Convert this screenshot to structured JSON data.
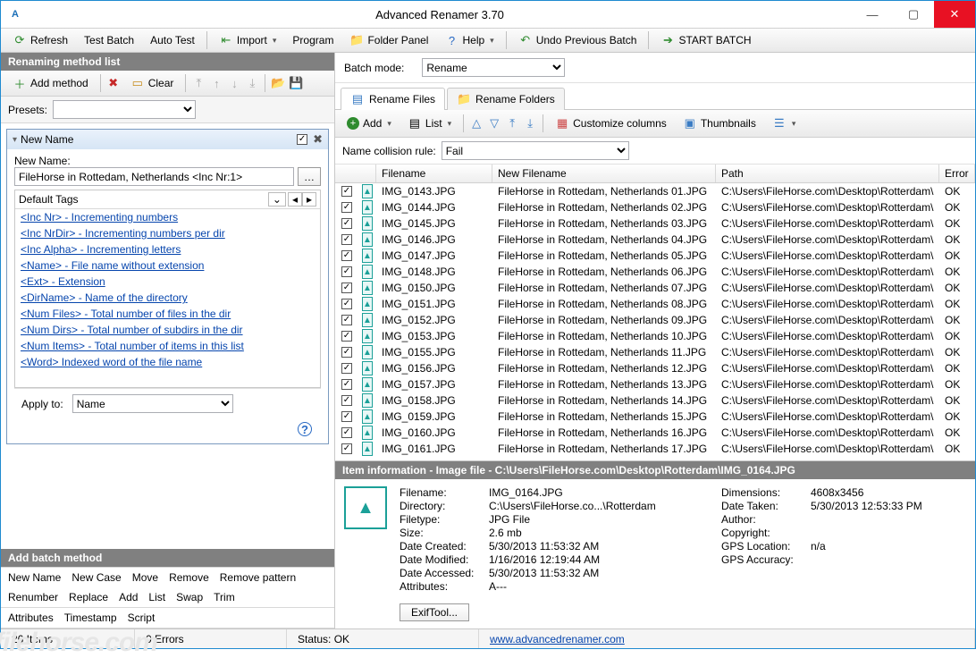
{
  "window": {
    "title": "Advanced Renamer 3.70"
  },
  "toolbar": {
    "refresh": "Refresh",
    "test_batch": "Test Batch",
    "auto_test": "Auto Test",
    "import": "Import",
    "program": "Program",
    "folder_panel": "Folder Panel",
    "help": "Help",
    "undo": "Undo Previous Batch",
    "start": "START BATCH"
  },
  "left": {
    "header": "Renaming method list",
    "add_method": "Add method",
    "clear": "Clear",
    "presets_label": "Presets:",
    "method": {
      "title": "New Name",
      "new_name_label": "New Name:",
      "new_name_value": "FileHorse in Rottedam, Netherlands <Inc Nr:1>",
      "default_tags": "Default Tags",
      "tags": [
        "<Inc Nr> - Incrementing numbers",
        "<Inc NrDir> - Incrementing numbers per dir",
        "<Inc Alpha> - Incrementing letters",
        "<Name> - File name without extension",
        "<Ext> - Extension",
        "<DirName> - Name of the directory",
        "<Num Files> - Total number of files in the dir",
        "<Num Dirs> - Total number of subdirs in the dir",
        "<Num Items> - Total number of items in this list",
        "<Word> Indexed word of the file name"
      ],
      "apply_to_label": "Apply to:",
      "apply_to_value": "Name"
    },
    "batch_header": "Add batch method",
    "batch_methods_1": [
      "New Name",
      "New Case",
      "Move",
      "Remove",
      "Remove pattern"
    ],
    "batch_methods_2": [
      "Renumber",
      "Replace",
      "Add",
      "List",
      "Swap",
      "Trim"
    ],
    "batch_methods_3": [
      "Attributes",
      "Timestamp",
      "Script"
    ]
  },
  "right": {
    "batch_mode_label": "Batch mode:",
    "batch_mode_value": "Rename",
    "tab_files": "Rename Files",
    "tab_folders": "Rename Folders",
    "add": "Add",
    "list": "List",
    "columns": "Customize columns",
    "thumbnails": "Thumbnails",
    "collision_label": "Name collision rule:",
    "collision_value": "Fail",
    "headers": {
      "filename": "Filename",
      "new_filename": "New Filename",
      "path": "Path",
      "error": "Error"
    },
    "files": [
      {
        "fn": "IMG_0143.JPG",
        "nn": "FileHorse in Rottedam, Netherlands 01.JPG",
        "p": "C:\\Users\\FileHorse.com\\Desktop\\Rotterdam\\",
        "e": "OK"
      },
      {
        "fn": "IMG_0144.JPG",
        "nn": "FileHorse in Rottedam, Netherlands 02.JPG",
        "p": "C:\\Users\\FileHorse.com\\Desktop\\Rotterdam\\",
        "e": "OK"
      },
      {
        "fn": "IMG_0145.JPG",
        "nn": "FileHorse in Rottedam, Netherlands 03.JPG",
        "p": "C:\\Users\\FileHorse.com\\Desktop\\Rotterdam\\",
        "e": "OK"
      },
      {
        "fn": "IMG_0146.JPG",
        "nn": "FileHorse in Rottedam, Netherlands 04.JPG",
        "p": "C:\\Users\\FileHorse.com\\Desktop\\Rotterdam\\",
        "e": "OK"
      },
      {
        "fn": "IMG_0147.JPG",
        "nn": "FileHorse in Rottedam, Netherlands 05.JPG",
        "p": "C:\\Users\\FileHorse.com\\Desktop\\Rotterdam\\",
        "e": "OK"
      },
      {
        "fn": "IMG_0148.JPG",
        "nn": "FileHorse in Rottedam, Netherlands 06.JPG",
        "p": "C:\\Users\\FileHorse.com\\Desktop\\Rotterdam\\",
        "e": "OK"
      },
      {
        "fn": "IMG_0150.JPG",
        "nn": "FileHorse in Rottedam, Netherlands 07.JPG",
        "p": "C:\\Users\\FileHorse.com\\Desktop\\Rotterdam\\",
        "e": "OK"
      },
      {
        "fn": "IMG_0151.JPG",
        "nn": "FileHorse in Rottedam, Netherlands 08.JPG",
        "p": "C:\\Users\\FileHorse.com\\Desktop\\Rotterdam\\",
        "e": "OK"
      },
      {
        "fn": "IMG_0152.JPG",
        "nn": "FileHorse in Rottedam, Netherlands 09.JPG",
        "p": "C:\\Users\\FileHorse.com\\Desktop\\Rotterdam\\",
        "e": "OK"
      },
      {
        "fn": "IMG_0153.JPG",
        "nn": "FileHorse in Rottedam, Netherlands 10.JPG",
        "p": "C:\\Users\\FileHorse.com\\Desktop\\Rotterdam\\",
        "e": "OK"
      },
      {
        "fn": "IMG_0155.JPG",
        "nn": "FileHorse in Rottedam, Netherlands 11.JPG",
        "p": "C:\\Users\\FileHorse.com\\Desktop\\Rotterdam\\",
        "e": "OK"
      },
      {
        "fn": "IMG_0156.JPG",
        "nn": "FileHorse in Rottedam, Netherlands 12.JPG",
        "p": "C:\\Users\\FileHorse.com\\Desktop\\Rotterdam\\",
        "e": "OK"
      },
      {
        "fn": "IMG_0157.JPG",
        "nn": "FileHorse in Rottedam, Netherlands 13.JPG",
        "p": "C:\\Users\\FileHorse.com\\Desktop\\Rotterdam\\",
        "e": "OK"
      },
      {
        "fn": "IMG_0158.JPG",
        "nn": "FileHorse in Rottedam, Netherlands 14.JPG",
        "p": "C:\\Users\\FileHorse.com\\Desktop\\Rotterdam\\",
        "e": "OK"
      },
      {
        "fn": "IMG_0159.JPG",
        "nn": "FileHorse in Rottedam, Netherlands 15.JPG",
        "p": "C:\\Users\\FileHorse.com\\Desktop\\Rotterdam\\",
        "e": "OK"
      },
      {
        "fn": "IMG_0160.JPG",
        "nn": "FileHorse in Rottedam, Netherlands 16.JPG",
        "p": "C:\\Users\\FileHorse.com\\Desktop\\Rotterdam\\",
        "e": "OK"
      },
      {
        "fn": "IMG_0161.JPG",
        "nn": "FileHorse in Rottedam, Netherlands 17.JPG",
        "p": "C:\\Users\\FileHorse.com\\Desktop\\Rotterdam\\",
        "e": "OK"
      }
    ],
    "info": {
      "header": "Item information - Image file - C:\\Users\\FileHorse.com\\Desktop\\Rotterdam\\IMG_0164.JPG",
      "left": {
        "Filename:": "IMG_0164.JPG",
        "Directory:": "C:\\Users\\FileHorse.co...\\Rotterdam",
        "Filetype:": "JPG File",
        "Size:": "2.6 mb",
        "Date Created:": "5/30/2013 11:53:32 AM",
        "Date Modified:": "1/16/2016 12:19:44 AM",
        "Date Accessed:": "5/30/2013 11:53:32 AM",
        "Attributes:": "A---"
      },
      "right": {
        "Dimensions:": "4608x3456",
        "Date Taken:": "5/30/2013 12:53:33 PM",
        "Author:": "",
        "Copyright:": "",
        "GPS Location:": "n/a",
        "GPS Accuracy:": ""
      },
      "exiftool": "ExifTool..."
    }
  },
  "status": {
    "items": "26 Items",
    "errors": "0 Errors",
    "status": "Status:   OK",
    "url": "www.advancedrenamer.com"
  },
  "watermark": "filehorse.com"
}
